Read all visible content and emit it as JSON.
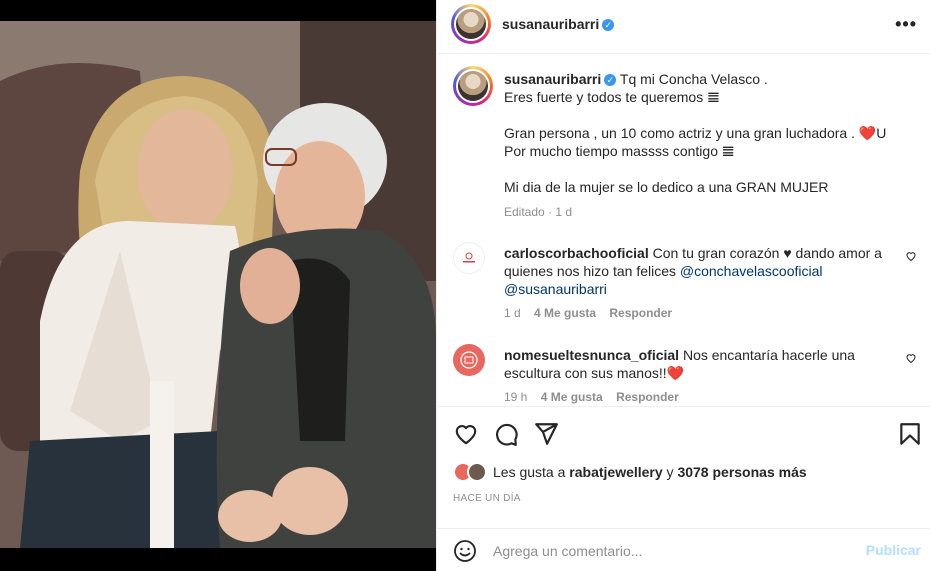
{
  "header": {
    "username": "susanauribarri",
    "more_icon": "more-horizontal-icon",
    "more_glyph": "•••"
  },
  "caption": {
    "username": "susanauribarri",
    "lines": [
      "Tq mi Concha Velasco .",
      "Eres fuerte y todos te queremos 𝌆",
      "",
      "Gran persona , un 10 como actriz y una gran luchadora . ❤️U",
      "Por mucho tiempo massss contigo 𝌆",
      "",
      "Mi dia de la mujer se lo dedico a una GRAN MUJER"
    ],
    "edited": "Editado",
    "separator": "·",
    "time": "1 d"
  },
  "comments": [
    {
      "username": "carloscorbachooficial",
      "text_before": "Con tu gran corazón ♥ dando amor a quienes nos hizo tan felices ",
      "mention1": "@conchavelascooficial",
      "mention2": "@susanauribarri",
      "time": "1 d",
      "likes": "4 Me gusta",
      "reply": "Responder"
    },
    {
      "username": "nomesueltesnunca_oficial",
      "text": "Nos encantaría hacerle una escultura con sus manos!!❤️",
      "time": "19 h",
      "likes": "4 Me gusta",
      "reply": "Responder"
    }
  ],
  "likes": {
    "prefix": "Les gusta a ",
    "user": "rabatjewellery",
    "connector": " y ",
    "count": "3078 personas más"
  },
  "date": "HACE UN DÍA",
  "add_comment": {
    "placeholder": "Agrega un comentario...",
    "publish": "Publicar"
  },
  "colors": {
    "verified": "#3897f0",
    "mention": "#00376b",
    "publish_disabled": "#b2dffc",
    "heart": "#ed4956"
  }
}
